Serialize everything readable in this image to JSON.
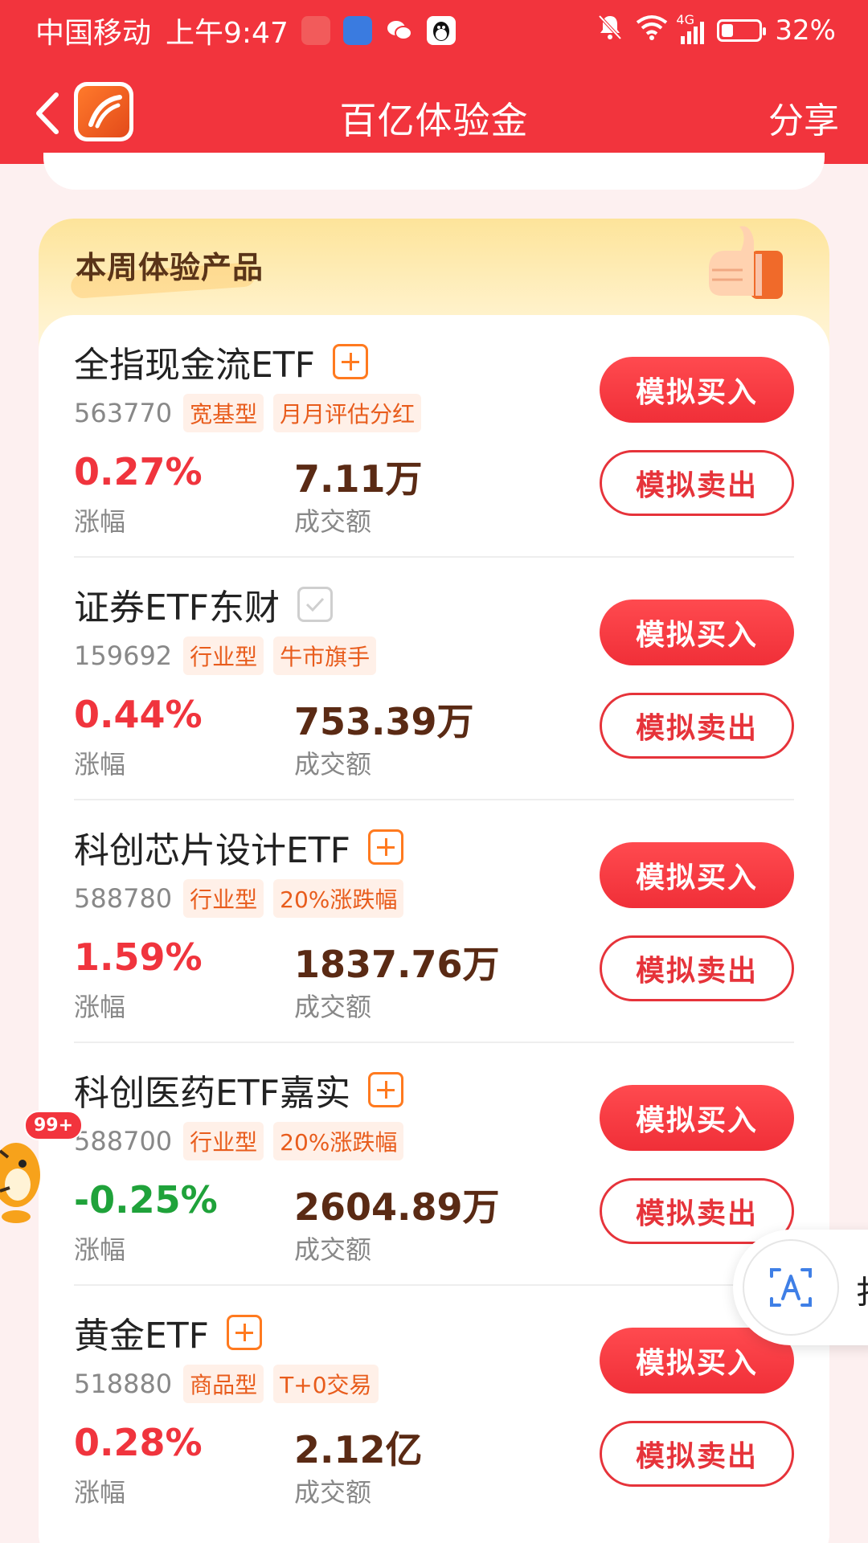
{
  "status_bar": {
    "carrier": "中国移动",
    "time": "上午9:47",
    "network": "4G",
    "battery": "32%",
    "battery_level": 0.32
  },
  "nav": {
    "title": "百亿体验金",
    "share": "分享"
  },
  "section": {
    "title": "本周体验产品"
  },
  "buttons": {
    "buy": "模拟买入",
    "sell": "模拟卖出"
  },
  "labels": {
    "change": "涨幅",
    "volume": "成交额"
  },
  "products": [
    {
      "name": "全指现金流ETF",
      "code": "563770",
      "tags": [
        "宽基型",
        "月月评估分红"
      ],
      "change": "0.27%",
      "volume": "7.11万",
      "added": false
    },
    {
      "name": "证券ETF东财",
      "code": "159692",
      "tags": [
        "行业型",
        "牛市旗手"
      ],
      "change": "0.44%",
      "volume": "753.39万",
      "added": true
    },
    {
      "name": "科创芯片设计ETF",
      "code": "588780",
      "tags": [
        "行业型",
        "20%涨跌幅"
      ],
      "change": "1.59%",
      "volume": "1837.76万",
      "added": false
    },
    {
      "name": "科创医药ETF嘉实",
      "code": "588700",
      "tags": [
        "行业型",
        "20%涨跌幅"
      ],
      "change": "-0.25%",
      "volume": "2604.89万",
      "added": false
    },
    {
      "name": "黄金ETF",
      "code": "518880",
      "tags": [
        "商品型",
        "T+0交易"
      ],
      "change": "0.28%",
      "volume": "2.12亿",
      "added": false
    }
  ],
  "floating": {
    "mascot_badge": "99+",
    "translate_icon": "translate-icon",
    "edge_text": "扌"
  },
  "colors": {
    "brand_red": "#f2343d",
    "up": "#f0343d",
    "down": "#1fa23a",
    "tag": "#e85c1c"
  }
}
